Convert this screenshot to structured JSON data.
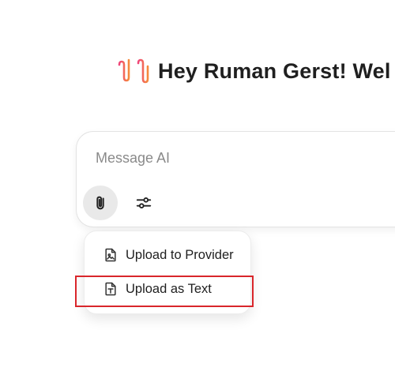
{
  "header": {
    "greeting": "Hey Ruman Gerst! Wel",
    "logo_icon": "soundwave-logo-icon",
    "logo_colors": [
      "#f0467a",
      "#f58a3c"
    ]
  },
  "composer": {
    "placeholder": "Message AI",
    "attach_icon": "paperclip-icon",
    "settings_icon": "sliders-icon"
  },
  "attach_menu": {
    "items": [
      {
        "label": "Upload to Provider",
        "icon": "file-image-icon"
      },
      {
        "label": "Upload as Text",
        "icon": "file-text-icon"
      }
    ]
  },
  "annotation": {
    "highlight_color": "#d9262b"
  }
}
